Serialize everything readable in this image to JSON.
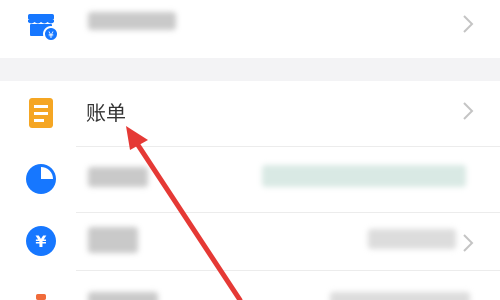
{
  "menu": {
    "store_row": {
      "icon": "store-icon",
      "accent": "#1677ff"
    },
    "bill_row": {
      "label": "账单",
      "icon": "bill-icon",
      "accent": "#f5a623"
    },
    "assets_row": {
      "icon": "pie-chart-icon",
      "accent": "#1677ff"
    },
    "yuan_row": {
      "icon": "yuan-icon",
      "accent": "#1677ff"
    },
    "last_row": {
      "icon": "tag-icon",
      "accent": "#f06b3a"
    }
  },
  "annotation": {
    "icon": "red-arrow-icon",
    "color": "#e53935"
  }
}
